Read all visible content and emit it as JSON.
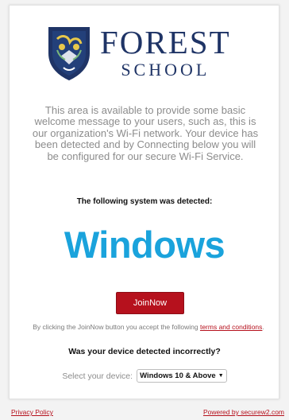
{
  "logo": {
    "line1": "FOREST",
    "line2": "SCHOOL"
  },
  "welcome": {
    "message": "This area is available to provide some basic welcome message to your users, such as, this is our organization's Wi-Fi network. Your device has been detected and by Connecting below you will be configured for our secure Wi-Fi Service."
  },
  "detection": {
    "heading": "The following system was detected:",
    "os_name": "Windows"
  },
  "join": {
    "button_label": "JoinNow",
    "terms_prefix": "By clicking the JoinNow button you accept the following",
    "terms_link": "terms and conditions",
    "terms_suffix": "."
  },
  "device_selection": {
    "question": "Was your device detected incorrectly?",
    "label": "Select your device:",
    "selected": "Windows 10 & Above"
  },
  "footer": {
    "privacy": "Privacy Policy",
    "powered_by": "Powered by securew2.com"
  },
  "colors": {
    "brand_navy": "#1f3466",
    "accent_red": "#b6111d",
    "os_blue": "#1aa3dc",
    "muted_text": "#8c8c8c"
  }
}
